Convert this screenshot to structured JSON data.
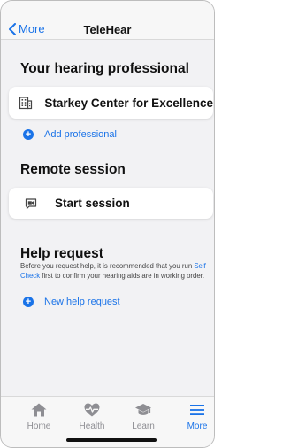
{
  "navbar": {
    "back_label": "More",
    "title": "TeleHear"
  },
  "professional_section": {
    "title": "Your hearing professional",
    "professional_name": "Starkey Center for Excellence",
    "professional_icon": "building-icon",
    "add_label": "Add professional"
  },
  "remote_section": {
    "title": "Remote session",
    "start_label": "Start session",
    "start_icon": "video-chat-icon"
  },
  "help_section": {
    "title": "Help request",
    "desc_before": "Before you request help, it is recommended that you run ",
    "desc_link": "Self Check",
    "desc_after": " first to confirm your hearing aids are in working order.",
    "new_label": "New help request"
  },
  "tabbar": {
    "tabs": [
      {
        "label": "Home",
        "icon": "home-icon"
      },
      {
        "label": "Health",
        "icon": "heart-pulse-icon"
      },
      {
        "label": "Learn",
        "icon": "graduation-cap-icon"
      },
      {
        "label": "More",
        "icon": "menu-icon",
        "active": true
      }
    ]
  },
  "colors": {
    "accent": "#1a73e8",
    "inactive": "#8e8e93",
    "background": "#f2f2f4"
  }
}
